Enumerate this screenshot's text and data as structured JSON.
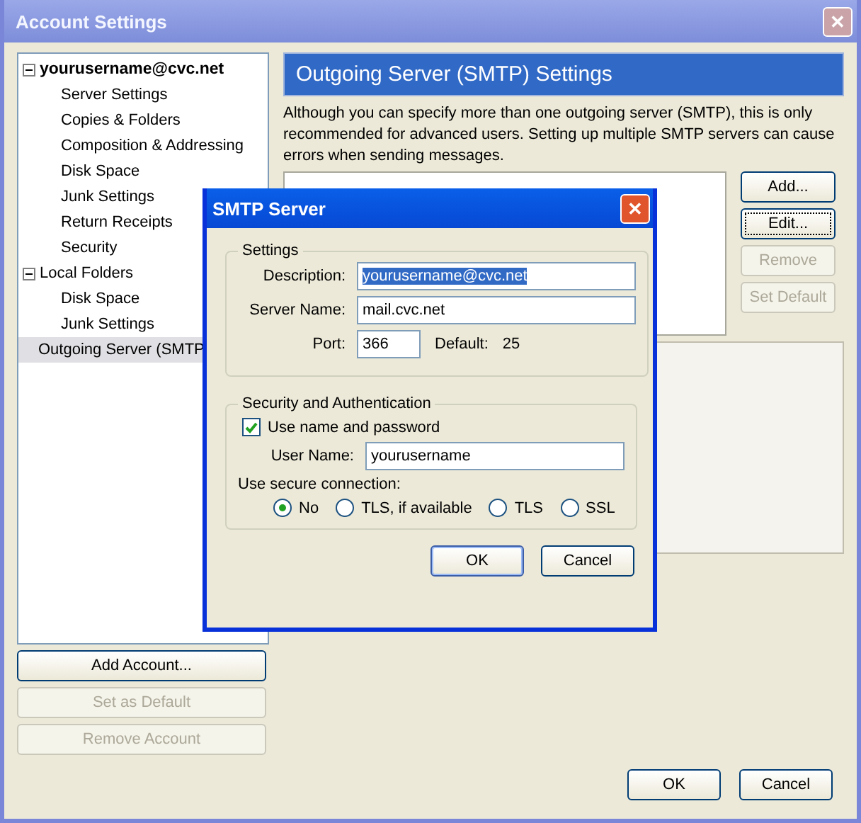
{
  "window": {
    "title": "Account Settings",
    "close": "✕"
  },
  "tree": [
    {
      "label": "yourusername@cvc.net",
      "default": true,
      "expanded": true,
      "selected": false,
      "children": [
        {
          "label": "Server Settings",
          "selected": false
        },
        {
          "label": "Copies & Folders",
          "selected": false
        },
        {
          "label": "Composition & Addressing",
          "selected": false
        },
        {
          "label": "Disk Space",
          "selected": false
        },
        {
          "label": "Junk Settings",
          "selected": false
        },
        {
          "label": "Return Receipts",
          "selected": false
        },
        {
          "label": "Security",
          "selected": false
        }
      ]
    },
    {
      "label": "Local Folders",
      "default": false,
      "expanded": true,
      "selected": false,
      "children": [
        {
          "label": "Disk Space",
          "selected": false
        },
        {
          "label": "Junk Settings",
          "selected": false
        }
      ]
    },
    {
      "label": "Outgoing Server (SMTP",
      "default": false,
      "selected": true
    }
  ],
  "account_buttons": [
    {
      "label": "Add Account...",
      "disabled": false
    },
    {
      "label": "Set as Default",
      "disabled": true
    },
    {
      "label": "Remove Account",
      "disabled": true
    }
  ],
  "panel": {
    "heading": "Outgoing Server (SMTP) Settings",
    "description": "Although you can specify more than one outgoing server (SMTP), this is only recommended for advanced users. Setting up multiple SMTP servers can cause errors when sending messages."
  },
  "server_buttons": [
    {
      "label": "Add...",
      "disabled": false,
      "focused": false
    },
    {
      "label": "Edit...",
      "disabled": false,
      "focused": true
    },
    {
      "label": "Remove",
      "disabled": true,
      "focused": false
    },
    {
      "label": "Set Default",
      "disabled": true,
      "focused": false
    }
  ],
  "footer_buttons": [
    {
      "label": "OK",
      "default": false
    },
    {
      "label": "Cancel",
      "default": false
    }
  ],
  "dialog": {
    "title": "SMTP Server",
    "close": "✕",
    "settings": {
      "legend": "Settings",
      "fields": [
        {
          "label": "Description:",
          "value": "yourusername@cvc.net",
          "selected": true
        },
        {
          "label": "Server Name:",
          "value": "mail.cvc.net",
          "selected": false
        }
      ],
      "port": {
        "label": "Port:",
        "value": "366"
      },
      "default_label": "Default:",
      "default_value": "25"
    },
    "security": {
      "legend": "Security and Authentication",
      "use_password": {
        "label": "Use name and password",
        "checked": true
      },
      "user_name": {
        "label": "User Name:",
        "value": "yourusername"
      },
      "secure_label": "Use secure connection:",
      "options": [
        {
          "label": "No",
          "selected": true
        },
        {
          "label": "TLS, if available",
          "selected": false
        },
        {
          "label": "TLS",
          "selected": false
        },
        {
          "label": "SSL",
          "selected": false
        }
      ]
    },
    "buttons": [
      {
        "label": "OK",
        "default": true
      },
      {
        "label": "Cancel",
        "default": false
      }
    ]
  }
}
